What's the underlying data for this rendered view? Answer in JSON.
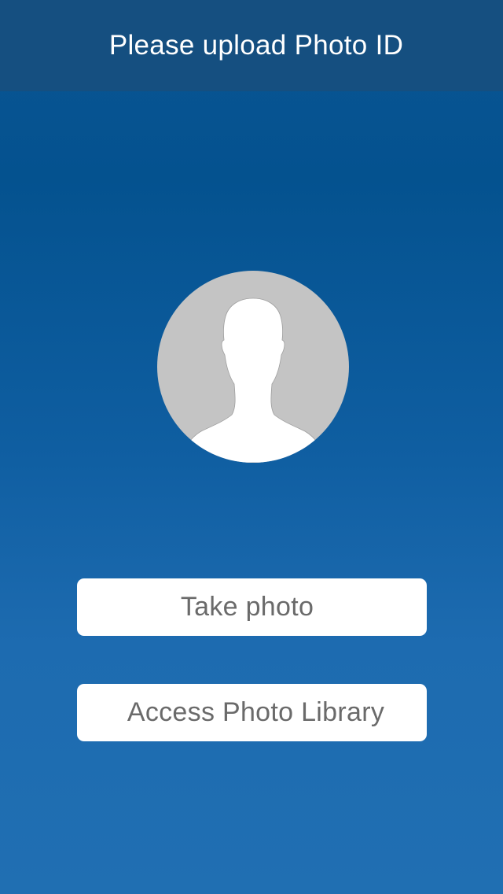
{
  "header": {
    "title": "Please upload Photo ID"
  },
  "avatar": {
    "icon": "person-silhouette-icon",
    "circle_color": "#c4c4c4",
    "silhouette_color": "#ffffff"
  },
  "actions": {
    "take_photo_label": "Take photo",
    "photo_library_label": "Access Photo Library"
  },
  "colors": {
    "header_background": "#154f80",
    "background_top": "#04528f",
    "background_bottom": "#206fb2",
    "button_background": "#ffffff",
    "button_text": "#6a6a6a"
  }
}
